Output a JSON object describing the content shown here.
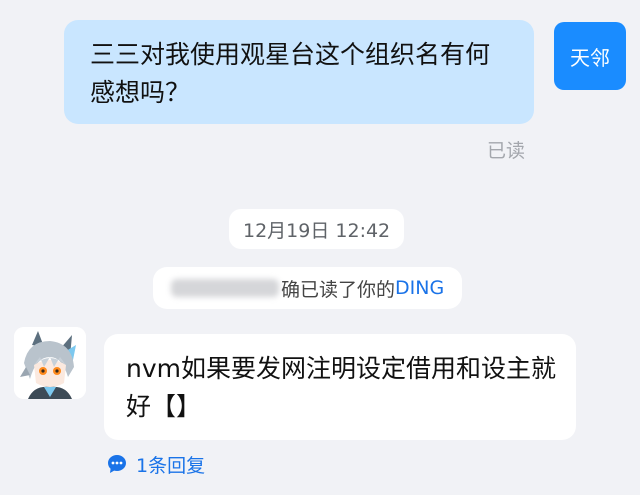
{
  "outgoing": {
    "text": "三三对我使用观星台这个组织名有何感想吗？",
    "avatar_label": "天邻",
    "read_status": "已读"
  },
  "timestamp": "12月19日 12:42",
  "ding_notice": {
    "text": "确已读了你的",
    "link": "DING"
  },
  "incoming": {
    "avatar_icon": "anime-character-avatar",
    "text": "nvm如果要发网注明设定借用和设主就好【】",
    "reply_count": "1条回复",
    "reply_icon": "comment-icon"
  },
  "colors": {
    "accent": "#1a8cff",
    "bubble_me": "#c9e6ff",
    "link": "#1a73e8",
    "background": "#f1f2f6"
  }
}
